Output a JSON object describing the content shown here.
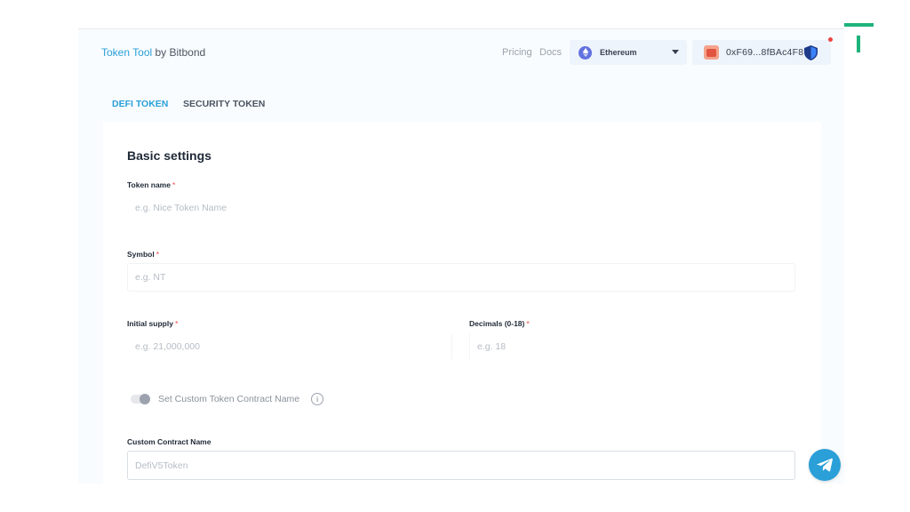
{
  "header": {
    "brand_accent": "Token Tool",
    "brand_rest": " by Bitbond",
    "nav": {
      "pricing": "Pricing",
      "docs": "Docs"
    },
    "network": {
      "selected": "Ethereum",
      "icon": "ethereum-icon"
    },
    "wallet": {
      "address": "0xF69...8fBAc4F8",
      "avatar_icon": "avatar-icon",
      "status_icon": "shield-icon"
    }
  },
  "tabs": [
    {
      "label": "DEFI TOKEN",
      "active": true
    },
    {
      "label": "SECURITY TOKEN",
      "active": false
    }
  ],
  "form": {
    "section_title": "Basic settings",
    "required_mark": "*",
    "token_name": {
      "label": "Token name",
      "placeholder": "e.g. Nice Token Name"
    },
    "symbol": {
      "label": "Symbol",
      "placeholder": "e.g. NT"
    },
    "initial_supply": {
      "label": "Initial supply",
      "placeholder": "e.g. 21,000,000"
    },
    "decimals": {
      "label": "Decimals (0-18)",
      "placeholder": "e.g. 18"
    },
    "custom_name_toggle": {
      "label": "Set Custom Token Contract Name",
      "info": "i"
    },
    "custom_contract_name": {
      "label": "Custom Contract Name",
      "placeholder": "DefiV5Token"
    }
  },
  "colors": {
    "accent": "#2a9fd8",
    "logo_green": "#1db37a",
    "required": "#ef4444"
  },
  "fab": {
    "icon": "telegram-icon"
  }
}
